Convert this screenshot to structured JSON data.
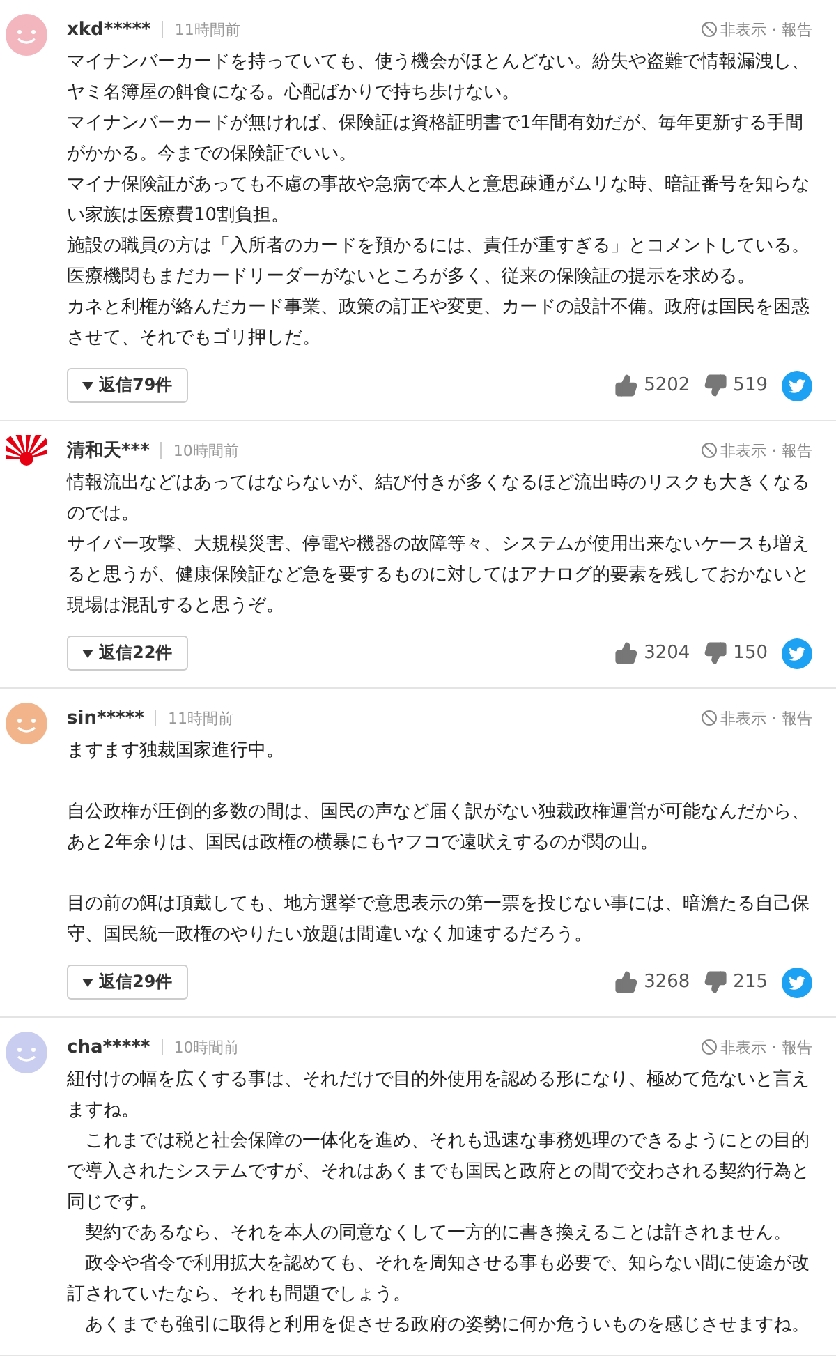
{
  "comments": [
    {
      "user": "xkd*****",
      "time": "11時間前",
      "report": "非表示・報告",
      "avatar": {
        "kind": "smiley",
        "color": "#f4b6be"
      },
      "paragraphs": [
        {
          "lines": [
            "マイナンバーカードを持っていても、使う機会がほとんどない。紛失や盗難で情報漏洩し、ヤミ名簿屋の餌食になる。心配ばかりで持ち歩けない。",
            "マイナンバーカードが無ければ、保険証は資格証明書で1年間有効だが、毎年更新する手間がかかる。今までの保険証でいい。",
            "マイナ保険証があっても不慮の事故や急病で本人と意思疎通がムリな時、暗証番号を知らない家族は医療費10割負担。",
            "施設の職員の方は「入所者のカードを預かるには、責任が重すぎる」とコメントしている。",
            "医療機関もまだカードリーダーがないところが多く、従来の保険証の提示を求める。",
            "カネと利権が絡んだカード事業、政策の訂正や変更、カードの設計不備。政府は国民を困惑させて、それでもゴリ押しだ。"
          ]
        }
      ],
      "replies": "返信79件",
      "likes": "5202",
      "dislikes": "519"
    },
    {
      "user": "清和天***",
      "time": "10時間前",
      "report": "非表示・報告",
      "avatar": {
        "kind": "sun",
        "color": "#e60012"
      },
      "paragraphs": [
        {
          "lines": [
            "情報流出などはあってはならないが、結び付きが多くなるほど流出時のリスクも大きくなるのでは。",
            "サイバー攻撃、大規模災害、停電や機器の故障等々、システムが使用出来ないケースも増えると思うが、健康保険証など急を要するものに対してはアナログ的要素を残しておかないと現場は混乱すると思うぞ。"
          ]
        }
      ],
      "replies": "返信22件",
      "likes": "3204",
      "dislikes": "150"
    },
    {
      "user": "sin*****",
      "time": "11時間前",
      "report": "非表示・報告",
      "avatar": {
        "kind": "smiley",
        "color": "#f2b48a"
      },
      "paragraphs": [
        {
          "lines": [
            "ますます独裁国家進行中。"
          ]
        },
        {
          "lines": [
            "自公政権が圧倒的多数の間は、国民の声など届く訳がない独裁政権運営が可能なんだから、あと2年余りは、国民は政権の横暴にもヤフコで遠吠えするのが関の山。"
          ]
        },
        {
          "lines": [
            "目の前の餌は頂戴しても、地方選挙で意思表示の第一票を投じない事には、暗澹たる自己保守、国民統一政権のやりたい放題は間違いなく加速するだろう。"
          ]
        }
      ],
      "replies": "返信29件",
      "likes": "3268",
      "dislikes": "215"
    },
    {
      "user": "cha*****",
      "time": "10時間前",
      "report": "非表示・報告",
      "avatar": {
        "kind": "smiley",
        "color": "#c9cdf0"
      },
      "paragraphs": [
        {
          "lines": [
            "紐付けの幅を広くする事は、それだけで目的外使用を認める形になり、極めて危ないと言えますね。",
            "　これまでは税と社会保障の一体化を進め、それも迅速な事務処理のできるようにとの目的で導入されたシステムですが、それはあくまでも国民と政府との間で交わされる契約行為と同じです。",
            "　契約であるなら、それを本人の同意なくして一方的に書き換えることは許されません。",
            "　政令や省令で利用拡大を認めても、それを周知させる事も必要で、知らない間に使途が改訂されていたなら、それも問題でしょう。",
            "　あくまでも強引に取得と利用を促させる政府の姿勢に何か危ういものを感じさせますね。"
          ]
        }
      ]
    }
  ]
}
